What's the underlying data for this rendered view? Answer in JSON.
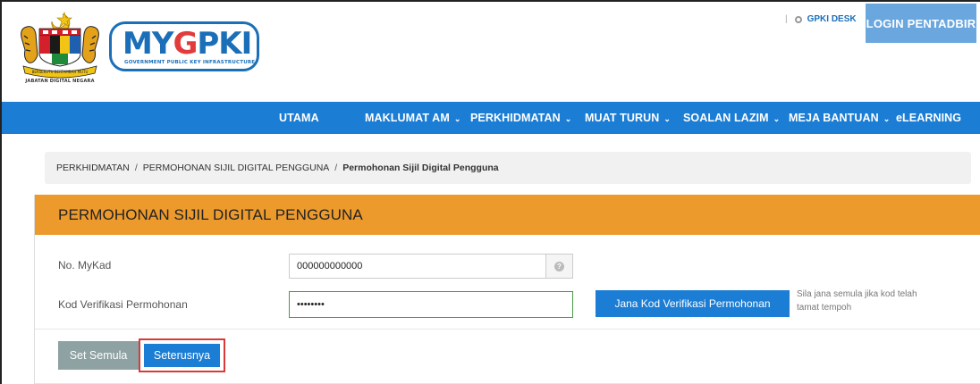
{
  "header": {
    "crest_caption": "JABATAN DIGITAL NEGARA",
    "logo_text_my": "MY",
    "logo_text_g": "G",
    "logo_text_pki": "PKI",
    "logo_subtitle": "GOVERNMENT PUBLIC KEY INFRASTRUCTURE",
    "top_link_separator": "|",
    "gpki_desk": "GPKI DESK",
    "login_label": "LOGIN PENTADBIR"
  },
  "nav": {
    "items": [
      {
        "label": "UTAMA",
        "has_dropdown": false
      },
      {
        "label": "MAKLUMAT AM",
        "has_dropdown": true
      },
      {
        "label": "PERKHIDMATAN",
        "has_dropdown": true
      },
      {
        "label": "MUAT TURUN",
        "has_dropdown": true
      },
      {
        "label": "SOALAN LAZIM",
        "has_dropdown": true
      },
      {
        "label": "MEJA BANTUAN",
        "has_dropdown": true
      },
      {
        "label": "eLEARNING",
        "has_dropdown": false
      }
    ],
    "chevron": "⌄"
  },
  "breadcrumb": {
    "items": [
      "PERKHIDMATAN",
      "PERMOHONAN SIJIL DIGITAL PENGGUNA"
    ],
    "current": "Permohonan Sijil Digital Pengguna",
    "separator": "/"
  },
  "panel": {
    "title": "PERMOHONAN SIJIL DIGITAL PENGGUNA",
    "mykad_label": "No. MyKad",
    "mykad_value": "000000000000",
    "help_icon": "?",
    "code_label": "Kod Verifikasi Permohonan",
    "code_value": "••••••••",
    "generate_button": "Jana Kod Verifikasi Permohonan",
    "hint_line1": "Sila jana semula jika kod telah",
    "hint_line2": "tamat tempoh",
    "reset_button": "Set Semula",
    "next_button": "Seterusnya"
  },
  "colors": {
    "nav_blue": "#1b7dd4",
    "panel_orange": "#ed9a2d",
    "login_blue": "#6aa7de",
    "reset_gray": "#8ea1a3",
    "highlight_red": "#d83a3a"
  }
}
